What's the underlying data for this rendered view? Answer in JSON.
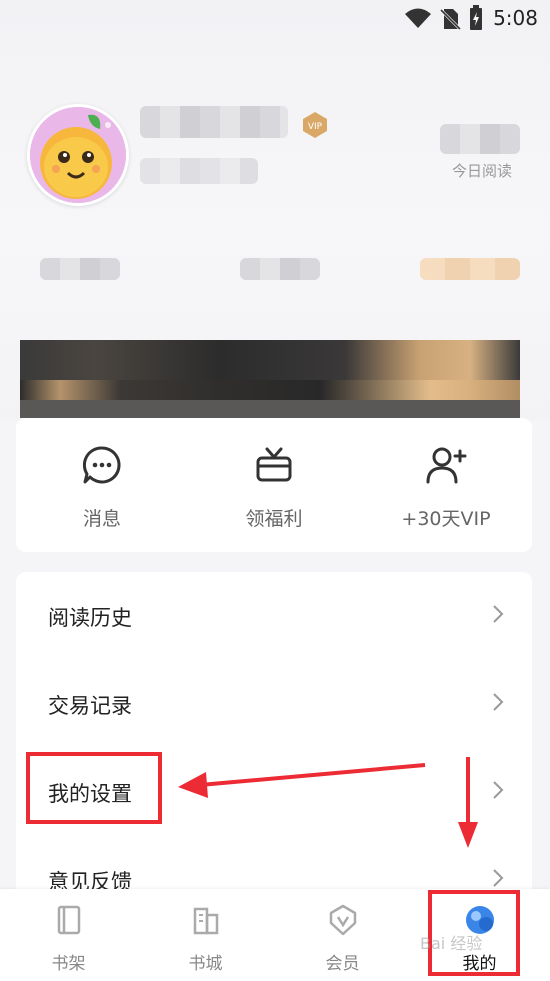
{
  "statusbar": {
    "time": "5:08"
  },
  "profile": {
    "vip_badge": "VIP",
    "today_label": "今日阅读"
  },
  "quick_actions": [
    {
      "label": "消息",
      "icon": "message-icon"
    },
    {
      "label": "领福利",
      "icon": "gift-tv-icon"
    },
    {
      "label": "+30天VIP",
      "icon": "add-user-icon"
    }
  ],
  "menu": [
    {
      "label": "阅读历史"
    },
    {
      "label": "交易记录"
    },
    {
      "label": "我的设置"
    },
    {
      "label": "意见反馈"
    }
  ],
  "nav": [
    {
      "label": "书架",
      "icon": "bookshelf-icon"
    },
    {
      "label": "书城",
      "icon": "bookstore-icon"
    },
    {
      "label": "会员",
      "icon": "vip-member-icon"
    },
    {
      "label": "我的",
      "icon": "profile-icon",
      "active": true
    }
  ],
  "colors": {
    "annotation_red": "#ec2b35",
    "accent_blue": "#3a86e8"
  },
  "watermark": "Bai 经验"
}
